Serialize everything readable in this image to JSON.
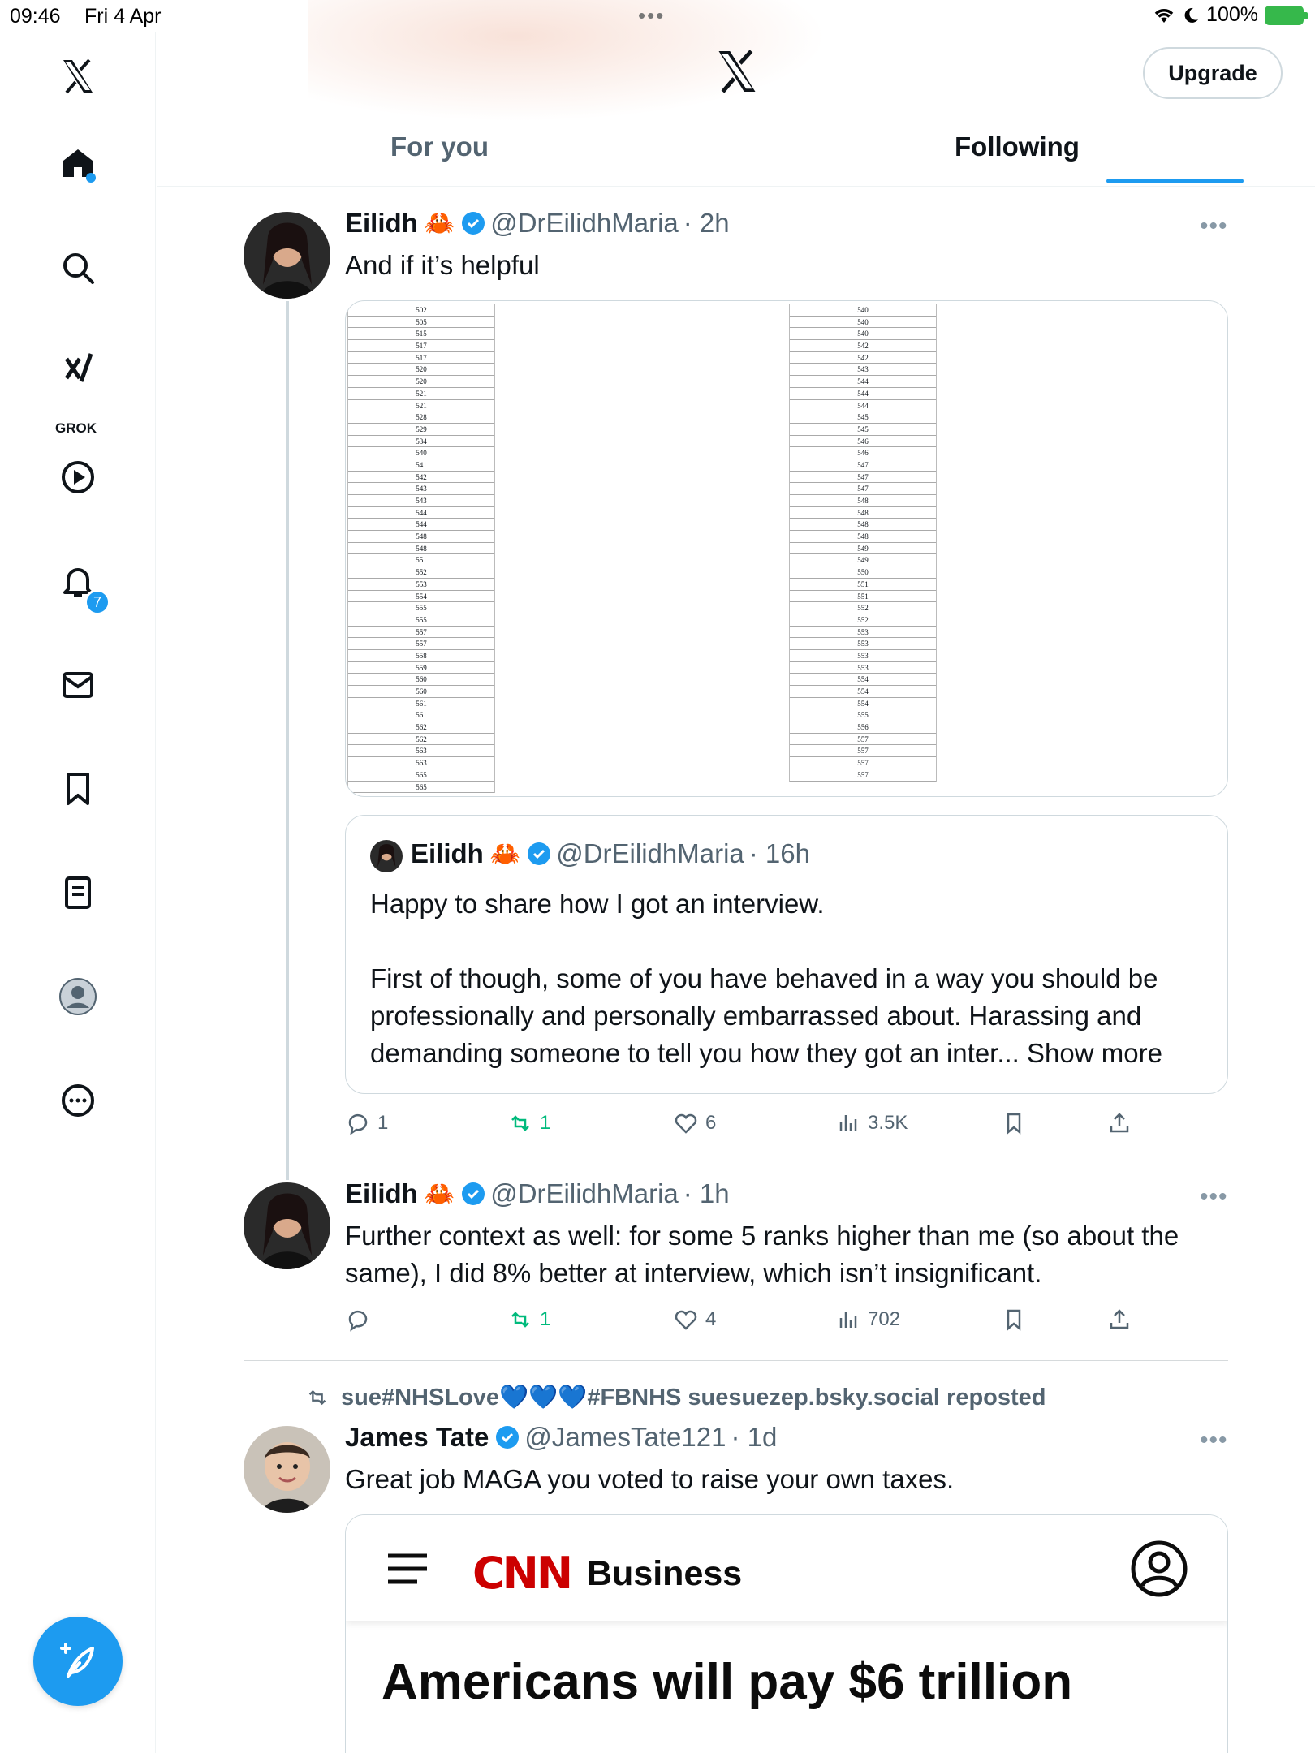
{
  "status_bar": {
    "time": "09:46",
    "date": "Fri 4 Apr",
    "battery": "100%"
  },
  "header": {
    "upgrade_label": "Upgrade"
  },
  "tabs": [
    {
      "label": "For you"
    },
    {
      "label": "Following"
    }
  ],
  "sidebar": {
    "grok_label": "GROK",
    "notifications_badge": "7"
  },
  "tweets": [
    {
      "name": "Eilidh",
      "emoji": "🦀",
      "handle": "@DrEilidhMaria",
      "time": "· 2h",
      "text": "And if it’s helpful",
      "media_table": {
        "col1": [
          "502",
          "505",
          "515",
          "517",
          "517",
          "520",
          "520",
          "521",
          "521",
          "528",
          "529",
          "534",
          "540",
          "541",
          "542",
          "543",
          "543",
          "544",
          "544",
          "548",
          "548",
          "551",
          "552",
          "553",
          "554",
          "555",
          "555",
          "557",
          "557",
          "558",
          "559",
          "560",
          "560",
          "561",
          "561",
          "562",
          "562",
          "563",
          "563",
          "565",
          "565"
        ],
        "col2": [
          "540",
          "540",
          "540",
          "542",
          "542",
          "543",
          "544",
          "544",
          "544",
          "545",
          "545",
          "546",
          "546",
          "547",
          "547",
          "547",
          "548",
          "548",
          "548",
          "548",
          "549",
          "549",
          "550",
          "551",
          "551",
          "552",
          "552",
          "553",
          "553",
          "553",
          "553",
          "554",
          "554",
          "554",
          "555",
          "556",
          "557",
          "557",
          "557",
          "557"
        ]
      },
      "quote": {
        "name": "Eilidh",
        "emoji": "🦀",
        "handle": "@DrEilidhMaria",
        "time": "· 16h",
        "text": "Happy to share how I got an interview.\n\nFirst of though, some of you have behaved in a way you should be professionally and personally embarrassed about. Harassing and demanding someone to tell you how they got an inter... Show more"
      },
      "actions": {
        "replies": "1",
        "reposts": "1",
        "likes": "6",
        "views": "3.5K"
      }
    },
    {
      "name": "Eilidh",
      "emoji": "🦀",
      "handle": "@DrEilidhMaria",
      "time": "· 1h",
      "text": "Further context as well: for some 5 ranks higher than me (so about the same), I did 8% better at interview, which isn’t insignificant.",
      "actions": {
        "replies": "",
        "reposts": "1",
        "likes": "4",
        "views": "702"
      }
    },
    {
      "repost_by": "sue#NHSLove💙💙💙#FBNHS suesuezep.bsky.social reposted",
      "name": "James Tate",
      "handle": "@JamesTate121",
      "time": "· 1d",
      "text": "Great job MAGA you voted to raise your own taxes.",
      "media": {
        "logo": "CNN",
        "section": "Business",
        "headline": "Americans will pay $6 trillion"
      }
    }
  ],
  "colors": {
    "accent": "#1d9bf0",
    "repost_green": "#00ba7c",
    "text_secondary": "#536471",
    "cnn_red": "#cc0000"
  }
}
